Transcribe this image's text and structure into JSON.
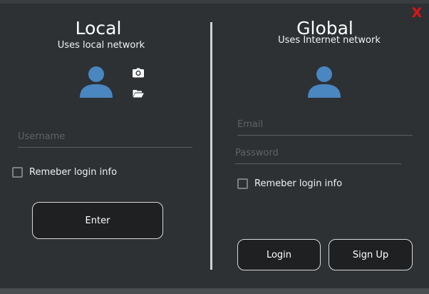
{
  "window": {
    "close_label": "X"
  },
  "local": {
    "title": "Local",
    "subtitle": "Uses local network",
    "username_placeholder": "Username",
    "remember_label": "Remeber login info",
    "enter_label": "Enter",
    "icons": [
      "user-avatar-icon",
      "camera-icon",
      "folder-open-icon"
    ]
  },
  "global": {
    "title": "Global",
    "subtitle": "Uses Internet network",
    "email_placeholder": "Email",
    "password_placeholder": "Password",
    "remember_label": "Remeber login info",
    "login_label": "Login",
    "signup_label": "Sign Up",
    "icons": [
      "user-avatar-icon"
    ]
  },
  "colors": {
    "background": "#2d3134",
    "avatar": "#4a86c0",
    "close": "#e01414",
    "button_bg": "#1f2022",
    "button_border": "#d9d9d9",
    "divider": "#cfd2d4"
  }
}
